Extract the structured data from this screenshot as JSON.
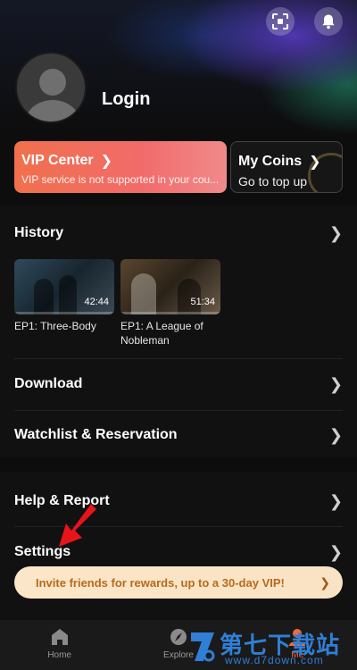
{
  "header": {
    "login_label": "Login",
    "icons": [
      "scan-icon",
      "bell-icon"
    ]
  },
  "vip_card": {
    "title": "VIP Center",
    "subtitle": "VIP service is not supported in your cou..."
  },
  "coins_card": {
    "title": "My Coins",
    "subtitle": "Go to top up"
  },
  "history": {
    "label": "History",
    "items": [
      {
        "title": "EP1: Three-Body",
        "duration": "42:44"
      },
      {
        "title": "EP1: A League of Nobleman",
        "duration": "51:34"
      }
    ]
  },
  "menu": {
    "download": "Download",
    "watchlist": "Watchlist & Reservation",
    "help": "Help & Report",
    "settings": "Settings"
  },
  "invite_banner": {
    "text": "Invite friends for rewards, up to a 30-day VIP!"
  },
  "bottom_nav": {
    "items": [
      {
        "label": "Home",
        "icon": "home-icon"
      },
      {
        "label": "Explore",
        "icon": "explore-icon"
      },
      {
        "label": "Me",
        "icon": "me-icon"
      }
    ],
    "active": "Me"
  },
  "watermark": {
    "text": "第七下载站",
    "url": "www.d7down.com"
  },
  "colors": {
    "accent": "#f26b3a",
    "vip_gradient_start": "#f0704d",
    "invite_text": "#b86a1c",
    "annotation_arrow": "#e8141c"
  }
}
